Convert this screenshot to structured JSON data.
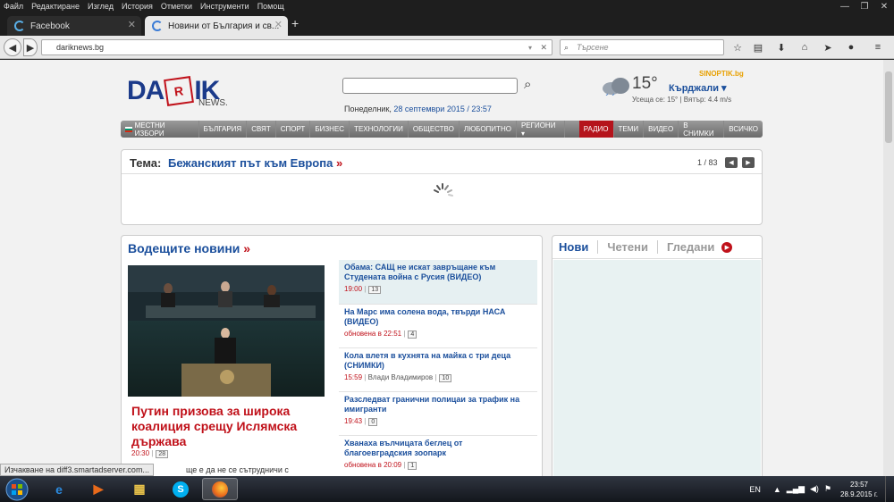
{
  "menubar": {
    "items": [
      "Файл",
      "Редактиране",
      "Изглед",
      "История",
      "Отметки",
      "Инструменти",
      "Помощ"
    ]
  },
  "window": {
    "minimize": "—",
    "maximize": "❐",
    "close": "✕"
  },
  "tabs": [
    {
      "label": "Facebook"
    },
    {
      "label": "Новини от България и св..."
    }
  ],
  "newtab": "+",
  "nav": {
    "url": "dariknews.bg",
    "search_placeholder": "Търсене"
  },
  "site": {
    "logo_left": "DA",
    "logo_cube": "R",
    "logo_right": "IK",
    "logo_sub": "NEWS.",
    "date_prefix": "Понеделник, ",
    "date_value": "28 септември 2015 / 23:57",
    "weather": {
      "temp": "15°",
      "city": "Кърджали ▾",
      "brand": "SINOPTIK.bg",
      "details": "Усеща се: 15° | Вятър: 4.4 m/s"
    }
  },
  "mainmenu": [
    "МЕСТНИ ИЗБОРИ",
    "БЪЛГАРИЯ",
    "СВЯТ",
    "СПОРТ",
    "БИЗНЕС",
    "ТЕХНОЛОГИИ",
    "ОБЩЕСТВО",
    "ЛЮБОПИТНО",
    "РЕГИОНИ ▾",
    "РАДИО",
    "ТЕМИ",
    "ВИДЕО",
    "В СНИМКИ",
    "ВСИЧКО"
  ],
  "tema": {
    "label": "Тема:",
    "value": "Бежанският път към Европа",
    "pager": "1 / 83"
  },
  "lead": {
    "title": "Водещите новини",
    "main_title": "Путин призова за широка коалиция срещу Ислямска държава",
    "main_time": "20:30",
    "main_count": "28",
    "main_tease": "ще е да не се сътрудничи с"
  },
  "news": [
    {
      "title": "Обама: САЩ не искат завръщане към Студената война с Русия (ВИДЕО)",
      "time": "19:00",
      "author": "",
      "count": "13"
    },
    {
      "title": "На Марс има солена вода, твърди НАСА (ВИДЕО)",
      "time": "обновена в 22:51",
      "author": "",
      "count": "4"
    },
    {
      "title": "Кола влетя в кухнята на майка с три деца (СНИМКИ)",
      "time": "15:59",
      "author": "Влади Владимиров",
      "count": "10"
    },
    {
      "title": "Разследват гранични полицаи за трафик на имигранти",
      "time": "19:43",
      "author": "",
      "count": "0"
    },
    {
      "title": "Хванаха вълчицата беглец от благоевградския зоопарк",
      "time": "обновена в 20:09",
      "author": "",
      "count": "1"
    }
  ],
  "rtabs": [
    "Нови",
    "Четени",
    "Гледани"
  ],
  "status": "Изчакване на diff3.smartadserver.com...",
  "tray": {
    "lang": "EN",
    "time": "23:57",
    "date": "28.9.2015 г."
  }
}
